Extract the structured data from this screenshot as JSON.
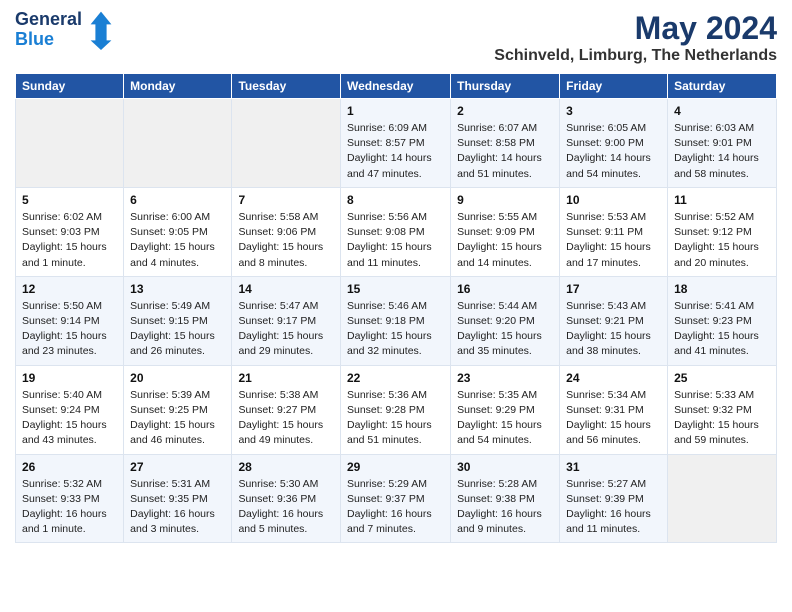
{
  "header": {
    "logo_line1": "General",
    "logo_line2": "Blue",
    "title": "May 2024",
    "subtitle": "Schinveld, Limburg, The Netherlands"
  },
  "columns": [
    "Sunday",
    "Monday",
    "Tuesday",
    "Wednesday",
    "Thursday",
    "Friday",
    "Saturday"
  ],
  "weeks": [
    [
      {
        "day": "",
        "empty": true
      },
      {
        "day": "",
        "empty": true
      },
      {
        "day": "",
        "empty": true
      },
      {
        "day": "1",
        "sunrise": "6:09 AM",
        "sunset": "8:57 PM",
        "daylight": "14 hours and 47 minutes."
      },
      {
        "day": "2",
        "sunrise": "6:07 AM",
        "sunset": "8:58 PM",
        "daylight": "14 hours and 51 minutes."
      },
      {
        "day": "3",
        "sunrise": "6:05 AM",
        "sunset": "9:00 PM",
        "daylight": "14 hours and 54 minutes."
      },
      {
        "day": "4",
        "sunrise": "6:03 AM",
        "sunset": "9:01 PM",
        "daylight": "14 hours and 58 minutes."
      }
    ],
    [
      {
        "day": "5",
        "sunrise": "6:02 AM",
        "sunset": "9:03 PM",
        "daylight": "15 hours and 1 minute."
      },
      {
        "day": "6",
        "sunrise": "6:00 AM",
        "sunset": "9:05 PM",
        "daylight": "15 hours and 4 minutes."
      },
      {
        "day": "7",
        "sunrise": "5:58 AM",
        "sunset": "9:06 PM",
        "daylight": "15 hours and 8 minutes."
      },
      {
        "day": "8",
        "sunrise": "5:56 AM",
        "sunset": "9:08 PM",
        "daylight": "15 hours and 11 minutes."
      },
      {
        "day": "9",
        "sunrise": "5:55 AM",
        "sunset": "9:09 PM",
        "daylight": "15 hours and 14 minutes."
      },
      {
        "day": "10",
        "sunrise": "5:53 AM",
        "sunset": "9:11 PM",
        "daylight": "15 hours and 17 minutes."
      },
      {
        "day": "11",
        "sunrise": "5:52 AM",
        "sunset": "9:12 PM",
        "daylight": "15 hours and 20 minutes."
      }
    ],
    [
      {
        "day": "12",
        "sunrise": "5:50 AM",
        "sunset": "9:14 PM",
        "daylight": "15 hours and 23 minutes."
      },
      {
        "day": "13",
        "sunrise": "5:49 AM",
        "sunset": "9:15 PM",
        "daylight": "15 hours and 26 minutes."
      },
      {
        "day": "14",
        "sunrise": "5:47 AM",
        "sunset": "9:17 PM",
        "daylight": "15 hours and 29 minutes."
      },
      {
        "day": "15",
        "sunrise": "5:46 AM",
        "sunset": "9:18 PM",
        "daylight": "15 hours and 32 minutes."
      },
      {
        "day": "16",
        "sunrise": "5:44 AM",
        "sunset": "9:20 PM",
        "daylight": "15 hours and 35 minutes."
      },
      {
        "day": "17",
        "sunrise": "5:43 AM",
        "sunset": "9:21 PM",
        "daylight": "15 hours and 38 minutes."
      },
      {
        "day": "18",
        "sunrise": "5:41 AM",
        "sunset": "9:23 PM",
        "daylight": "15 hours and 41 minutes."
      }
    ],
    [
      {
        "day": "19",
        "sunrise": "5:40 AM",
        "sunset": "9:24 PM",
        "daylight": "15 hours and 43 minutes."
      },
      {
        "day": "20",
        "sunrise": "5:39 AM",
        "sunset": "9:25 PM",
        "daylight": "15 hours and 46 minutes."
      },
      {
        "day": "21",
        "sunrise": "5:38 AM",
        "sunset": "9:27 PM",
        "daylight": "15 hours and 49 minutes."
      },
      {
        "day": "22",
        "sunrise": "5:36 AM",
        "sunset": "9:28 PM",
        "daylight": "15 hours and 51 minutes."
      },
      {
        "day": "23",
        "sunrise": "5:35 AM",
        "sunset": "9:29 PM",
        "daylight": "15 hours and 54 minutes."
      },
      {
        "day": "24",
        "sunrise": "5:34 AM",
        "sunset": "9:31 PM",
        "daylight": "15 hours and 56 minutes."
      },
      {
        "day": "25",
        "sunrise": "5:33 AM",
        "sunset": "9:32 PM",
        "daylight": "15 hours and 59 minutes."
      }
    ],
    [
      {
        "day": "26",
        "sunrise": "5:32 AM",
        "sunset": "9:33 PM",
        "daylight": "16 hours and 1 minute."
      },
      {
        "day": "27",
        "sunrise": "5:31 AM",
        "sunset": "9:35 PM",
        "daylight": "16 hours and 3 minutes."
      },
      {
        "day": "28",
        "sunrise": "5:30 AM",
        "sunset": "9:36 PM",
        "daylight": "16 hours and 5 minutes."
      },
      {
        "day": "29",
        "sunrise": "5:29 AM",
        "sunset": "9:37 PM",
        "daylight": "16 hours and 7 minutes."
      },
      {
        "day": "30",
        "sunrise": "5:28 AM",
        "sunset": "9:38 PM",
        "daylight": "16 hours and 9 minutes."
      },
      {
        "day": "31",
        "sunrise": "5:27 AM",
        "sunset": "9:39 PM",
        "daylight": "16 hours and 11 minutes."
      },
      {
        "day": "",
        "empty": true
      }
    ]
  ]
}
